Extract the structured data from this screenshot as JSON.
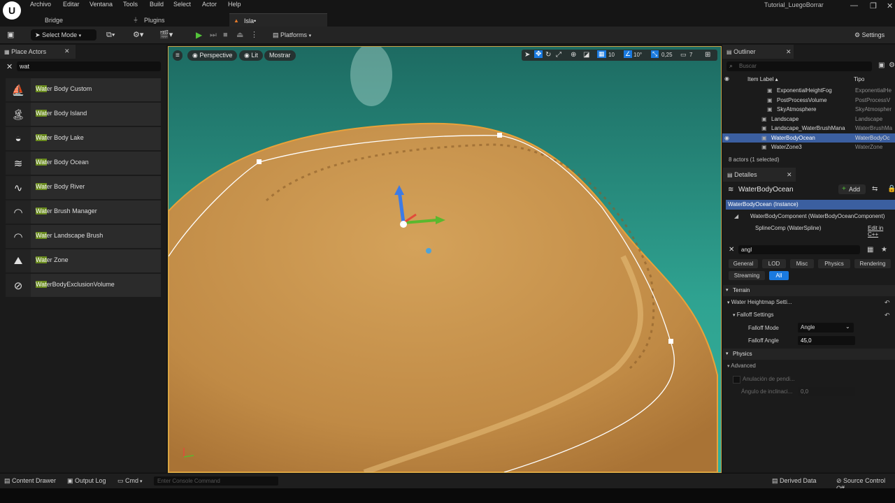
{
  "window": {
    "project_name": "Tutorial_LuegoBorrar",
    "logo": "U",
    "minimize": "—",
    "maximize": "❐",
    "close": "✕"
  },
  "menu": [
    "Archivo",
    "Editar",
    "Ventana",
    "Tools",
    "Build",
    "Select",
    "Actor",
    "Help"
  ],
  "tabs": [
    {
      "label": "Bridge",
      "icon": ""
    },
    {
      "label": "Plugins",
      "icon": "plug-icon"
    },
    {
      "label": "Isla•",
      "icon": "level-icon"
    }
  ],
  "toolbar": {
    "select_mode": "Select Mode",
    "platforms": "Platforms",
    "settings": "Settings"
  },
  "place_actors": {
    "tab_label": "Place Actors",
    "search_value": "wat",
    "items": [
      {
        "match": "Wat",
        "rest": "er Body Custom",
        "icon": "sailboat-icon",
        "glyph": "⛵"
      },
      {
        "match": "Wat",
        "rest": "er Body Island",
        "icon": "island-icon",
        "glyph": "🏝"
      },
      {
        "match": "Wat",
        "rest": "er Body Lake",
        "icon": "lake-icon",
        "glyph": "◒"
      },
      {
        "match": "Wat",
        "rest": "er Body Ocean",
        "icon": "ocean-icon",
        "glyph": "≋"
      },
      {
        "match": "Wat",
        "rest": "er Body River",
        "icon": "river-icon",
        "glyph": "∿"
      },
      {
        "match": "Wat",
        "rest": "er Brush Manager",
        "icon": "wave-icon",
        "glyph": "◠"
      },
      {
        "match": "Wat",
        "rest": "er Landscape Brush",
        "icon": "landscape-brush-icon",
        "glyph": "◠"
      },
      {
        "match": "Wat",
        "rest": "er Zone",
        "icon": "water-zone-icon",
        "glyph": "⛰"
      },
      {
        "match": "Wat",
        "rest": "erBodyExclusionVolume",
        "icon": "exclusion-icon",
        "glyph": "⊘"
      }
    ]
  },
  "viewport": {
    "perspective": "Perspective",
    "lit": "Lit",
    "show": "Mostrar",
    "grid_snap": "10",
    "angle_snap": "10°",
    "scale_snap": "0,25",
    "camera_speed": "7"
  },
  "outliner": {
    "tab_label": "Outliner",
    "search_placeholder": "Buscar",
    "col_label": "Item Label ▴",
    "col_type": "Tipo",
    "rows": [
      {
        "name": "ExponentialHeightFog",
        "type": "ExponentialHe",
        "selected": false,
        "indent": 1
      },
      {
        "name": "PostProcessVolume",
        "type": "PostProcessV",
        "selected": false,
        "indent": 1
      },
      {
        "name": "SkyAtmosphere",
        "type": "SkyAtmospher",
        "selected": false,
        "indent": 1
      },
      {
        "name": "Landscape",
        "type": "Landscape",
        "selected": false,
        "indent": 0
      },
      {
        "name": "Landscape_WaterBrushMana",
        "type": "WaterBrushMa",
        "selected": false,
        "indent": 0
      },
      {
        "name": "WaterBodyOcean",
        "type": "WaterBodyOc",
        "selected": true,
        "indent": 0
      },
      {
        "name": "WaterZone3",
        "type": "WaterZone",
        "selected": false,
        "indent": 0
      }
    ],
    "summary": "8 actors (1 selected)"
  },
  "details": {
    "tab_label": "Detalles",
    "actor_name": "WaterBodyOcean",
    "add_label": "Add",
    "instance": "WaterBodyOcean (Instance)",
    "component": "WaterBodyComponent (WaterBodyOceanComponent)",
    "spline": "SplineComp (WaterSpline)",
    "edit_cpp": "Edit in C++",
    "search_value": "angl",
    "filters": [
      "General",
      "LOD",
      "Misc",
      "Physics",
      "Rendering",
      "Streaming",
      "All"
    ],
    "terrain": "Terrain",
    "heightmap": "Water Heightmap Setti...",
    "falloff_settings": "Falloff Settings",
    "falloff_mode_label": "Falloff Mode",
    "falloff_mode_value": "Angle",
    "falloff_angle_label": "Falloff Angle",
    "falloff_angle_value": "45,0",
    "physics": "Physics",
    "advanced": "Advanced",
    "slope_label": "Anulación de pendi...",
    "slope_angle_label": "Ángulo de inclinaci...",
    "slope_angle_value": "0,0"
  },
  "status": {
    "content_drawer": "Content Drawer",
    "output_log": "Output Log",
    "cmd": "Cmd",
    "console_placeholder": "Enter Console Command",
    "derived_data": "Derived Data",
    "source_control": "Source Control Off"
  },
  "colors": {
    "water": "#2fa391",
    "sand": "#c8944a",
    "selection": "#3b5fa0",
    "search_highlight": "#6a8b1e",
    "play_green": "#54c43a",
    "accent_blue": "#1a7ae0"
  }
}
